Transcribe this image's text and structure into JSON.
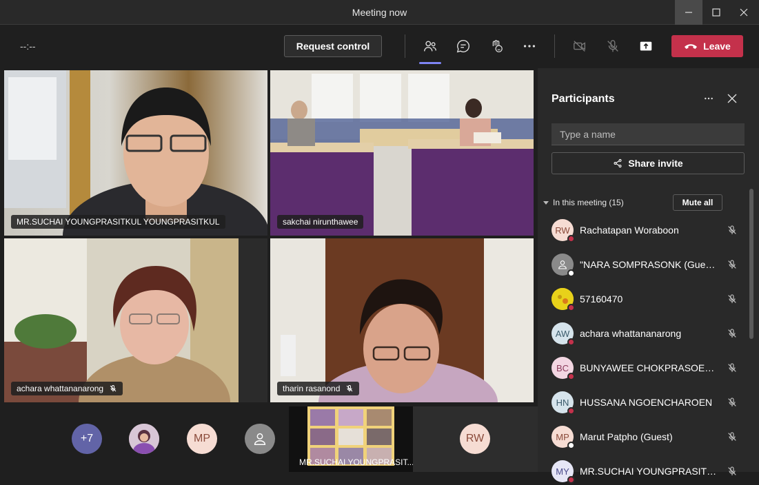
{
  "window": {
    "title": "Meeting now"
  },
  "toolbar": {
    "timer": "--:--",
    "request_control": "Request control",
    "leave": "Leave"
  },
  "tiles": [
    {
      "name": "MR.SUCHAI YOUNGPRASITKUL YOUNGPRASITKUL",
      "muted": false
    },
    {
      "name": "sakchai nirunthawee",
      "muted": false
    },
    {
      "name": "achara whattananarong",
      "muted": true
    },
    {
      "name": "tharin rasanond",
      "muted": true
    }
  ],
  "strip": {
    "overflow": "+7",
    "mp": "MP",
    "rw": "RW",
    "shared_label": "MR.SUCHAI YOUNGPRASIT..."
  },
  "panel": {
    "title": "Participants",
    "search_placeholder": "Type a name",
    "share_invite": "Share invite",
    "section": "In this meeting (15)",
    "mute_all": "Mute all",
    "participants": [
      {
        "initials": "RW",
        "name": "Rachatapan Woraboon",
        "bg": "#f6dcd3",
        "fg": "#8a4a3a",
        "status": "#c4314b"
      },
      {
        "initials": "",
        "name": "\"NARA SOMPRASONK (Guest)\"",
        "bg": "#8a8a8a",
        "fg": "#ffffff",
        "status": "#ffffff"
      },
      {
        "initials": "",
        "name": "57160470",
        "bg": "#e8d11a",
        "fg": "#333333",
        "status": "#c4314b"
      },
      {
        "initials": "AW",
        "name": "achara whattananarong",
        "bg": "#d6e4ec",
        "fg": "#3a5a6a",
        "status": "#c4314b"
      },
      {
        "initials": "BC",
        "name": "BUNYAWEE CHOKPRASOETS...",
        "bg": "#f3d6e2",
        "fg": "#8a3a5a",
        "status": "#c4314b"
      },
      {
        "initials": "HN",
        "name": "HUSSANA NGOENCHAROEN",
        "bg": "#d6e4ec",
        "fg": "#3a5a6a",
        "status": "#c4314b"
      },
      {
        "initials": "MP",
        "name": "Marut Patpho (Guest)",
        "bg": "#f6dcd3",
        "fg": "#8a4a3a",
        "status": "#ffffff"
      },
      {
        "initials": "MY",
        "name": "MR.SUCHAI YOUNGPRASITK...",
        "bg": "#e6e6f6",
        "fg": "#4a4a8a",
        "status": "#c4314b"
      }
    ]
  }
}
